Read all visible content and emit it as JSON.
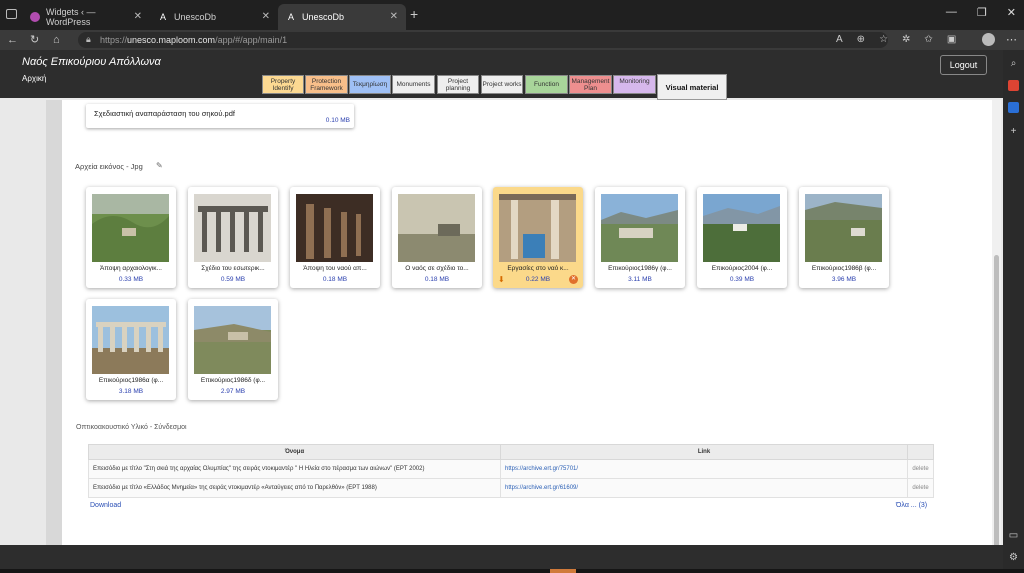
{
  "browser": {
    "tabs": [
      {
        "label": "Widgets ‹ — WordPress",
        "favicon": "wordpress-icon"
      },
      {
        "label": "UnescoDb",
        "favicon": "A"
      },
      {
        "label": "UnescoDb",
        "favicon": "A"
      }
    ],
    "url_prefix": "https://",
    "url_host": "unesco.maploom.com",
    "url_path": "/app/#/app/main/1"
  },
  "header": {
    "title": "Ναός Επικούριου Απόλλωνα",
    "subtitle": "Αρχική",
    "logout_label": "Logout"
  },
  "menu": [
    {
      "label": "Property Identify",
      "color": "#fcd992"
    },
    {
      "label": "Protection Framework",
      "color": "#f8bf8a"
    },
    {
      "label": "Τεκμηρίωση",
      "color": "#9fc0f5"
    },
    {
      "label": "Monuments",
      "color": "#eeeeee"
    },
    {
      "label": "Project planning",
      "color": "#eeeeee"
    },
    {
      "label": "Project works",
      "color": "#eeeeee"
    },
    {
      "label": "Function",
      "color": "#a8d59a"
    },
    {
      "label": "Management Plan",
      "color": "#ee8f8f"
    },
    {
      "label": "Monitoring",
      "color": "#d6b8ec"
    },
    {
      "label": "Visual material",
      "color": "#f0f0f0"
    }
  ],
  "document": {
    "name": "Σχεδιαστική αναπαράσταση του σηκού.pdf",
    "size": "0.10 MB"
  },
  "images_section": {
    "title": "Αρχεία εικόνος - Jpg",
    "items": [
      {
        "caption": "Άποψη αρχαιολογικ...",
        "size": "0.33 MB"
      },
      {
        "caption": "Σχέδιο του εσωτερικ...",
        "size": "0.59 MB"
      },
      {
        "caption": "Άποψη του ναού απ...",
        "size": "0.18 MB"
      },
      {
        "caption": "Ο ναός σε σχέδιο το...",
        "size": "0.18 MB"
      },
      {
        "caption": "Εργασίες στο ναό κ...",
        "size": "0.22 MB"
      },
      {
        "caption": "Επικούριος1986γ (φ...",
        "size": "3.11 MB"
      },
      {
        "caption": "Επικούριος2004 (φ...",
        "size": "0.39 MB"
      },
      {
        "caption": "Επικούριος1986β (φ...",
        "size": "3.96 MB"
      },
      {
        "caption": "Επικούριος1986α (φ...",
        "size": "3.18 MB"
      },
      {
        "caption": "Επικούριος1986δ (φ...",
        "size": "2.97 MB"
      }
    ]
  },
  "av_section": {
    "title": "Οπτικοακουστικό Υλικό - Σύνδεσμοι",
    "col_name": "Όνομα",
    "col_link": "Link",
    "rows": [
      {
        "name": "Επεισόδιο με τίτλο \"Στη σκιά της αρχαίας Ολυμπίας\" της σειράς ντοκιμαντέρ \" Η Ηλεία στο πέρασμα των αιώνων\" (ΕΡΤ 2002)",
        "link": "https://archive.ert.gr/75701/",
        "action": "delete"
      },
      {
        "name": "Επεισόδιο με τίτλο «Ελλάδος Μνημεία» της σειράς ντοκιμαντέρ «Ανταύγειες από το Παρελθόν» (ΕΡΤ 1988)",
        "link": "https://archive.ert.gr/61609/",
        "action": "delete"
      }
    ],
    "download_label": "Download",
    "all_label": "Όλα ... (3)"
  }
}
